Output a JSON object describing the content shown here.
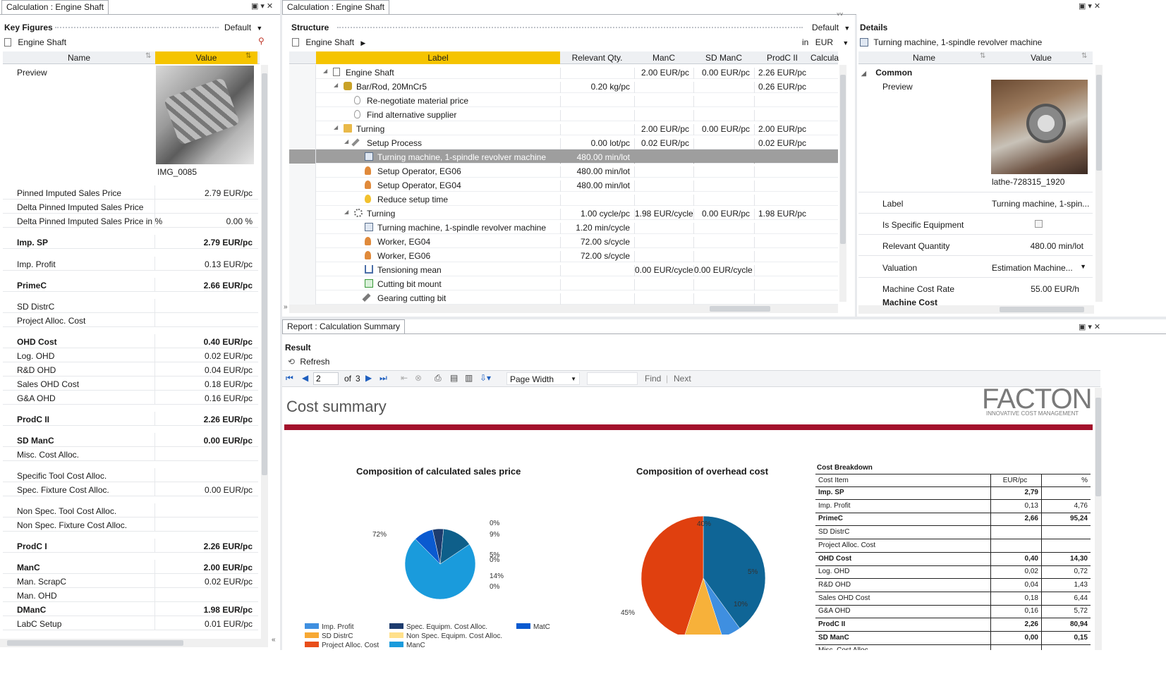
{
  "left": {
    "tab": "Calculation : Engine Shaft",
    "section": "Key Figures",
    "default_label": "Default",
    "object": "Engine Shaft",
    "col_name": "Name",
    "col_value": "Value",
    "preview_label": "Preview",
    "preview_caption": "IMG_0085",
    "rows": [
      {
        "name": "Pinned Imputed Sales Price",
        "value": "2.79 EUR/pc",
        "bold": false
      },
      {
        "name": "Delta Pinned Imputed Sales Price",
        "value": "",
        "bold": false
      },
      {
        "name": "Delta Pinned Imputed Sales Price in %",
        "value": "0.00 %",
        "bold": false
      },
      {
        "name": "Imp. SP",
        "value": "2.79 EUR/pc",
        "bold": true
      },
      {
        "name": "Imp. Profit",
        "value": "0.13 EUR/pc",
        "bold": false
      },
      {
        "name": "PrimeC",
        "value": "2.66 EUR/pc",
        "bold": true
      },
      {
        "name": "SD DistrC",
        "value": "",
        "bold": false
      },
      {
        "name": "Project Alloc. Cost",
        "value": "",
        "bold": false
      },
      {
        "name": "OHD Cost",
        "value": "0.40 EUR/pc",
        "bold": true
      },
      {
        "name": "Log. OHD",
        "value": "0.02 EUR/pc",
        "bold": false
      },
      {
        "name": "R&D OHD",
        "value": "0.04 EUR/pc",
        "bold": false
      },
      {
        "name": "Sales OHD Cost",
        "value": "0.18 EUR/pc",
        "bold": false
      },
      {
        "name": "G&A OHD",
        "value": "0.16 EUR/pc",
        "bold": false
      },
      {
        "name": "ProdC II",
        "value": "2.26 EUR/pc",
        "bold": true
      },
      {
        "name": "SD ManC",
        "value": "0.00 EUR/pc",
        "bold": true
      },
      {
        "name": "Misc. Cost Alloc.",
        "value": "",
        "bold": false
      },
      {
        "name": "Specific Tool Cost Alloc.",
        "value": "",
        "bold": false
      },
      {
        "name": "Spec. Fixture Cost Alloc.",
        "value": "0.00 EUR/pc",
        "bold": false
      },
      {
        "name": "Non Spec. Tool Cost Alloc.",
        "value": "",
        "bold": false
      },
      {
        "name": "Non Spec. Fixture Cost Alloc.",
        "value": "",
        "bold": false
      },
      {
        "name": "ProdC I",
        "value": "2.26 EUR/pc",
        "bold": true
      },
      {
        "name": "ManC",
        "value": "2.00 EUR/pc",
        "bold": true
      },
      {
        "name": "Man. ScrapC",
        "value": "0.02 EUR/pc",
        "bold": false
      },
      {
        "name": "Man. OHD",
        "value": "",
        "bold": false
      },
      {
        "name": "DManC",
        "value": "1.98 EUR/pc",
        "bold": true
      },
      {
        "name": "LabC Setup",
        "value": "0.01 EUR/pc",
        "bold": false
      }
    ]
  },
  "center": {
    "tab": "Calculation : Engine Shaft",
    "section": "Structure",
    "default_label": "Default",
    "in_label": "in",
    "currency": "EUR",
    "object": "Engine Shaft",
    "cols": [
      "Label",
      "Relevant Qty.",
      "ManC",
      "SD ManC",
      "ProdC II",
      "Calcula"
    ],
    "rows": [
      {
        "label": "Engine Shaft",
        "qty": "",
        "manc": "2.00 EUR/pc",
        "sdmanc": "0.00 EUR/pc",
        "prodc": "2.26 EUR/pc",
        "icon": "document-icon"
      },
      {
        "label": "Bar/Rod, 20MnCr5",
        "qty": "0.20 kg/pc",
        "manc": "",
        "sdmanc": "",
        "prodc": "0.26 EUR/pc",
        "icon": "material-icon"
      },
      {
        "label": "Re-negotiate material price",
        "qty": "",
        "manc": "",
        "sdmanc": "",
        "prodc": "",
        "icon": "idea-off-icon"
      },
      {
        "label": "Find alternative supplier",
        "qty": "",
        "manc": "",
        "sdmanc": "",
        "prodc": "",
        "icon": "idea-off-icon"
      },
      {
        "label": "Turning",
        "qty": "",
        "manc": "2.00 EUR/pc",
        "sdmanc": "0.00 EUR/pc",
        "prodc": "2.00 EUR/pc",
        "icon": "folder-icon"
      },
      {
        "label": "Setup Process",
        "qty": "0.00 lot/pc",
        "manc": "0.02 EUR/pc",
        "sdmanc": "",
        "prodc": "0.02 EUR/pc",
        "icon": "wrench-icon"
      },
      {
        "label": "Turning machine, 1-spindle revolver machine",
        "qty": "480.00 min/lot",
        "manc": "",
        "sdmanc": "",
        "prodc": "",
        "icon": "machine-icon"
      },
      {
        "label": "Setup Operator, EG06",
        "qty": "480.00 min/lot",
        "manc": "",
        "sdmanc": "",
        "prodc": "",
        "icon": "person-icon"
      },
      {
        "label": "Setup Operator, EG04",
        "qty": "480.00 min/lot",
        "manc": "",
        "sdmanc": "",
        "prodc": "",
        "icon": "person-icon"
      },
      {
        "label": "Reduce setup time",
        "qty": "",
        "manc": "",
        "sdmanc": "",
        "prodc": "",
        "icon": "idea-on-icon"
      },
      {
        "label": "Turning",
        "qty": "1.00 cycle/pc",
        "manc": "1.98 EUR/cycle",
        "sdmanc": "0.00 EUR/pc",
        "prodc": "1.98 EUR/pc",
        "icon": "gear-icon"
      },
      {
        "label": "Turning machine, 1-spindle revolver machine",
        "qty": "1.20 min/cycle",
        "manc": "",
        "sdmanc": "",
        "prodc": "",
        "icon": "machine-icon"
      },
      {
        "label": "Worker, EG04",
        "qty": "72.00 s/cycle",
        "manc": "",
        "sdmanc": "",
        "prodc": "",
        "icon": "person-icon"
      },
      {
        "label": "Worker, EG06",
        "qty": "72.00 s/cycle",
        "manc": "",
        "sdmanc": "",
        "prodc": "",
        "icon": "person-icon"
      },
      {
        "label": "Tensioning mean",
        "qty": "",
        "manc": "0.00 EUR/cycle",
        "sdmanc": "0.00 EUR/cycle",
        "prodc": "",
        "icon": "clamp-icon"
      },
      {
        "label": "Cutting bit mount",
        "qty": "",
        "manc": "",
        "sdmanc": "",
        "prodc": "",
        "icon": "mount-icon"
      },
      {
        "label": "Gearing cutting bit",
        "qty": "",
        "manc": "",
        "sdmanc": "",
        "prodc": "",
        "icon": "tools-icon"
      }
    ]
  },
  "details": {
    "section": "Details",
    "object": "Turning machine, 1-spindle revolver machine",
    "col_name": "Name",
    "col_value": "Value",
    "group": "Common",
    "preview_label": "Preview",
    "preview_caption": "lathe-728315_1920",
    "label_name": "Label",
    "label_value": "Turning machine, 1-spin...",
    "specific_name": "Is Specific Equipment",
    "relqty_name": "Relevant Quantity",
    "relqty_value": "480.00 min/lot",
    "valuation_name": "Valuation",
    "valuation_value": "Estimation Machine...",
    "rate_name": "Machine Cost Rate",
    "rate_value": "55.00 EUR/h",
    "machcost_name": "Machine Cost"
  },
  "report": {
    "tab": "Report : Calculation Summary",
    "section": "Result",
    "refresh": "Refresh",
    "page": "2",
    "of": "of",
    "pages": "3",
    "zoom": "Page Width",
    "find": "Find",
    "next": "Next",
    "title": "Cost summary",
    "logo": "FACTON",
    "logo_sub": "INNOVATIVE COST MANAGEMENT",
    "breakdown_title": "Cost Breakdown",
    "breakdown_head": [
      "Cost Item",
      "EUR/pc",
      "%"
    ],
    "breakdown": [
      {
        "item": "Imp. SP",
        "eur": "2,79",
        "pct": "",
        "bold": true
      },
      {
        "item": "Imp. Profit",
        "eur": "0,13",
        "pct": "4,76",
        "bold": false
      },
      {
        "item": "PrimeC",
        "eur": "2,66",
        "pct": "95,24",
        "bold": true
      },
      {
        "item": "SD DistrC",
        "eur": "",
        "pct": "",
        "bold": false
      },
      {
        "item": "Project Alloc. Cost",
        "eur": "",
        "pct": "",
        "bold": false
      },
      {
        "item": "OHD Cost",
        "eur": "0,40",
        "pct": "14,30",
        "bold": true
      },
      {
        "item": "Log. OHD",
        "eur": "0,02",
        "pct": "0,72",
        "bold": false
      },
      {
        "item": "R&D OHD",
        "eur": "0,04",
        "pct": "1,43",
        "bold": false
      },
      {
        "item": "Sales OHD Cost",
        "eur": "0,18",
        "pct": "6,44",
        "bold": false
      },
      {
        "item": "G&A OHD",
        "eur": "0,16",
        "pct": "5,72",
        "bold": false
      },
      {
        "item": "ProdC II",
        "eur": "2,26",
        "pct": "80,94",
        "bold": true
      },
      {
        "item": "SD ManC",
        "eur": "0,00",
        "pct": "0,15",
        "bold": true
      },
      {
        "item": "Misc. Cost Alloc.",
        "eur": "",
        "pct": "",
        "bold": false
      }
    ]
  },
  "chart_data": [
    {
      "type": "pie",
      "title": "Composition of calculated sales price",
      "labels": [
        "Imp. Profit",
        "SD DistrC",
        "Project Alloc. Cost",
        "Spec. Equipm. Cost Alloc.",
        "Non Spec. Equipm. Cost Alloc.",
        "ManC",
        "MatC"
      ],
      "slices": [
        {
          "name": "ManC",
          "pct": 72,
          "label": "72%",
          "color": "#1a9bdc"
        },
        {
          "name": "Imp. Profit",
          "pct": 0,
          "label": "0%",
          "color": "#3f8fe0"
        },
        {
          "name": "MatC",
          "pct": 9,
          "label": "9%",
          "color": "#0a5ad0"
        },
        {
          "name": "Spec. Equipm. Cost Alloc.",
          "pct": 5,
          "label": "5%",
          "color": "#1d3c6e"
        },
        {
          "name": "SD DistrC",
          "pct": 0,
          "label": "0%",
          "color": "#f7a833"
        },
        {
          "name": "OHD",
          "pct": 14,
          "label": "14%",
          "color": "#0e5f8a"
        },
        {
          "name": "Project Alloc. Cost",
          "pct": 0,
          "label": "0%",
          "color": "#e84e1a"
        }
      ],
      "legend": [
        {
          "name": "Imp. Profit",
          "color": "#3f8fe0"
        },
        {
          "name": "Spec. Equipm. Cost Alloc.",
          "color": "#1d3c6e"
        },
        {
          "name": "MatC",
          "color": "#0a5ad0"
        },
        {
          "name": "SD DistrC",
          "color": "#f7a833"
        },
        {
          "name": "Non Spec. Equipm. Cost Alloc.",
          "color": "#ffe08a"
        },
        {
          "name": "Project Alloc. Cost",
          "color": "#e84e1a"
        },
        {
          "name": "ManC",
          "color": "#1a9bdc"
        }
      ]
    },
    {
      "type": "pie",
      "title": "Composition of overhead cost",
      "slices": [
        {
          "name": "Sales OHD Cost",
          "pct": 40,
          "label": "40%",
          "color": "#0f6596"
        },
        {
          "name": "R&D OHD",
          "pct": 5,
          "label": "5%",
          "color": "#3f8fe0"
        },
        {
          "name": "Log. OHD",
          "pct": 10,
          "label": "10%",
          "color": "#f7b13a"
        },
        {
          "name": "G&A OHD",
          "pct": 45,
          "label": "45%",
          "color": "#e0400f"
        }
      ]
    }
  ],
  "colors": {
    "header_yellow": "#f5c400",
    "accent_red": "#a3112b",
    "selected_row": "#9e9e9e"
  }
}
